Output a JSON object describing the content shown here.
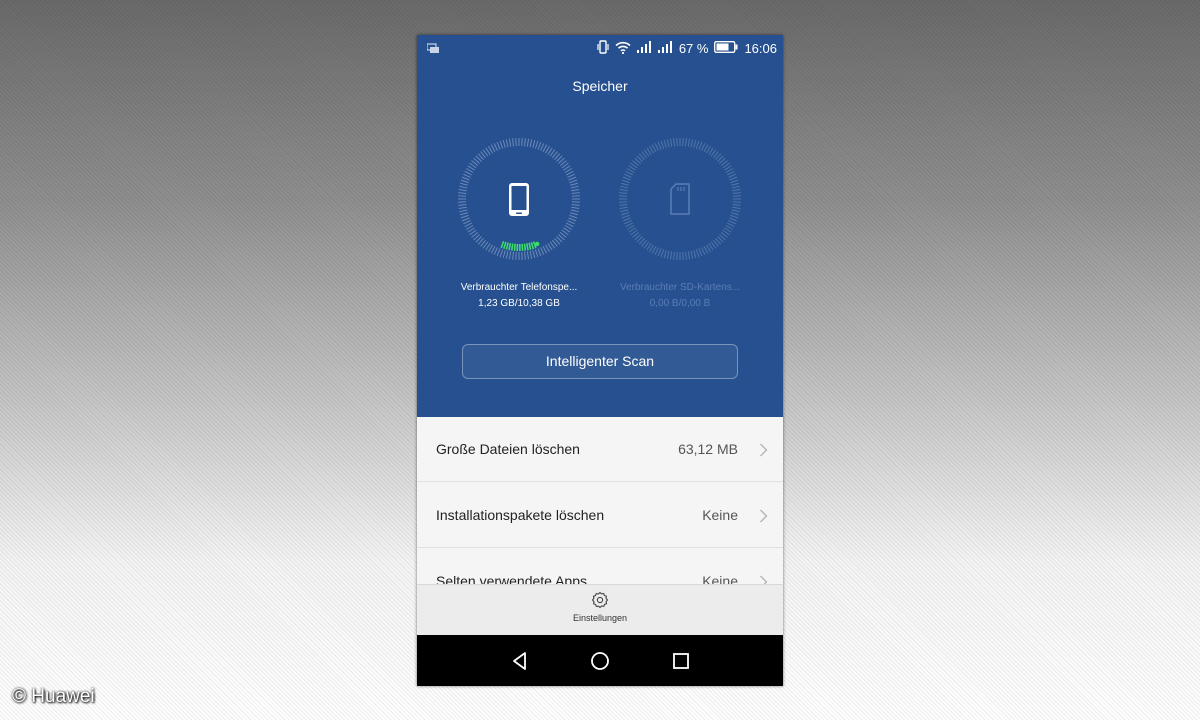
{
  "status_bar": {
    "battery_percent": "67 %",
    "time": "16:06",
    "icons": [
      "notification-icon",
      "vibrate-icon",
      "wifi-icon",
      "signal-icon",
      "signal-icon",
      "battery-icon"
    ]
  },
  "screen": {
    "title": "Speicher"
  },
  "storage": {
    "phone": {
      "label": "Verbrauchter Telefonspe...",
      "value": "1,23 GB/10,38 GB",
      "used_fraction": 0.12,
      "icon": "smartphone-icon"
    },
    "sd": {
      "label": "Verbrauchter SD-Kartens...",
      "value": "0,00 B/0,00 B",
      "used_fraction": 0,
      "icon": "sd-card-icon"
    }
  },
  "scan_button": {
    "label": "Intelligenter Scan"
  },
  "list": [
    {
      "label": "Große Dateien löschen",
      "value": "63,12 MB"
    },
    {
      "label": "Installationspakete löschen",
      "value": "Keine"
    },
    {
      "label": "Selten verwendete Apps",
      "value": "Keine"
    }
  ],
  "bottom_bar": {
    "settings_label": "Einstellungen",
    "settings_icon": "gear-icon"
  },
  "nav": {
    "icons": [
      "back-icon",
      "home-icon",
      "recents-icon"
    ]
  },
  "watermark": "© Huawei",
  "colors": {
    "header_blue": "#26508f",
    "progress_green": "#3ddc6b",
    "ring_gray": "#8aa3c9"
  }
}
